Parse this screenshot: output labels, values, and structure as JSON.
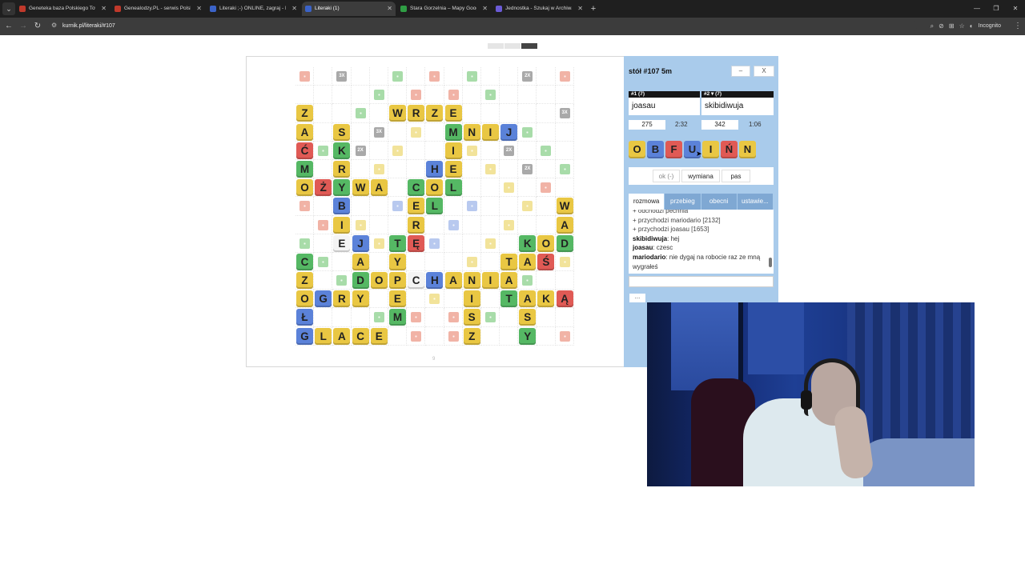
{
  "browser": {
    "tabs": [
      {
        "title": "Geneteka baza Polskiego Towa",
        "active": false,
        "icon_color": "#c0392b"
      },
      {
        "title": "Genealodzy.PL - serwis Polskiego",
        "active": false,
        "icon_color": "#c0392b"
      },
      {
        "title": "Literaki ;-) ONLINE, zagraj - Ku",
        "active": false,
        "icon_color": "#3b63c8"
      },
      {
        "title": "Literaki (1)",
        "active": true,
        "icon_color": "#3b63c8"
      },
      {
        "title": "Stara Gorzelnia – Mapy Google",
        "active": false,
        "icon_color": "#2f9e44"
      },
      {
        "title": "Jednostka - Szukaj w Archiwach",
        "active": false,
        "icon_color": "#6b5bd6"
      }
    ],
    "new_tab_label": "+",
    "url": "kurnik.pl/literaki/#107",
    "incognito_label": "Incognito"
  },
  "game": {
    "table_title": "stół #107   5m",
    "minimize_label": "–",
    "close_label": "X",
    "players": [
      {
        "header": "#1   (7)",
        "name": "joasau",
        "score": "275",
        "time": "2:32"
      },
      {
        "header": "#2 ▾ (7)",
        "name": "skibidiwuja",
        "score": "342",
        "time": "1:06"
      }
    ],
    "rack": [
      {
        "letter": "O",
        "color": "#e9c743"
      },
      {
        "letter": "B",
        "color": "#5b82d9"
      },
      {
        "letter": "F",
        "color": "#e05a55"
      },
      {
        "letter": "U",
        "color": "#5b82d9"
      },
      {
        "letter": "I",
        "color": "#e9c743"
      },
      {
        "letter": "Ń",
        "color": "#e05a55"
      },
      {
        "letter": "N",
        "color": "#e9c743"
      }
    ],
    "actions": {
      "ok": "ok (-)",
      "exchange": "wymiana",
      "pass": "pas"
    },
    "chat_tabs": [
      "rozmowa",
      "przebieg",
      "obecni",
      "ustawie..."
    ],
    "chat_lines": [
      {
        "kind": "sys",
        "text": "+ odchodzi pechnia"
      },
      {
        "kind": "sys",
        "text": "+ przychodzi mariodario [2132]"
      },
      {
        "kind": "sys",
        "text": "+ przychodzi joasau [1653]"
      },
      {
        "kind": "msg",
        "user": "skibidiwuja",
        "text": ": hej"
      },
      {
        "kind": "msg",
        "user": "joasau",
        "text": ": czesc"
      },
      {
        "kind": "msg",
        "user": "mariodario",
        "text": ": nie dygaj na robocie raz ze mną wygrałeś"
      }
    ],
    "more_label": "...",
    "board_footer": "9"
  },
  "colors": {
    "yellow": "#e9c743",
    "green": "#55b864",
    "blue": "#5b82d9",
    "red": "#e05a55",
    "white": "#f4f4f4"
  },
  "board": {
    "tiles": [
      [
        2,
        0,
        "Z",
        "y"
      ],
      [
        2,
        5,
        "W",
        "y"
      ],
      [
        2,
        6,
        "R",
        "y"
      ],
      [
        2,
        7,
        "Z",
        "y"
      ],
      [
        2,
        8,
        "E",
        "y"
      ],
      [
        3,
        0,
        "A",
        "y"
      ],
      [
        3,
        2,
        "S",
        "y"
      ],
      [
        3,
        8,
        "M",
        "g"
      ],
      [
        3,
        9,
        "N",
        "y"
      ],
      [
        3,
        10,
        "I",
        "y"
      ],
      [
        3,
        11,
        "J",
        "b"
      ],
      [
        4,
        0,
        "Ć",
        "r"
      ],
      [
        4,
        2,
        "K",
        "g"
      ],
      [
        4,
        8,
        "I",
        "y"
      ],
      [
        5,
        0,
        "M",
        "g"
      ],
      [
        5,
        2,
        "R",
        "y"
      ],
      [
        5,
        7,
        "H",
        "b"
      ],
      [
        5,
        8,
        "E",
        "y"
      ],
      [
        6,
        0,
        "O",
        "y"
      ],
      [
        6,
        1,
        "Ż",
        "r"
      ],
      [
        6,
        2,
        "Y",
        "g"
      ],
      [
        6,
        3,
        "W",
        "y"
      ],
      [
        6,
        4,
        "A",
        "y"
      ],
      [
        6,
        6,
        "C",
        "g"
      ],
      [
        6,
        7,
        "O",
        "y"
      ],
      [
        6,
        8,
        "L",
        "g"
      ],
      [
        7,
        2,
        "B",
        "b"
      ],
      [
        7,
        6,
        "E",
        "y"
      ],
      [
        7,
        7,
        "L",
        "g"
      ],
      [
        7,
        14,
        "W",
        "y"
      ],
      [
        8,
        2,
        "I",
        "y"
      ],
      [
        8,
        6,
        "R",
        "y"
      ],
      [
        8,
        14,
        "A",
        "y"
      ],
      [
        9,
        2,
        "E",
        "w"
      ],
      [
        9,
        3,
        "J",
        "b"
      ],
      [
        9,
        5,
        "T",
        "g"
      ],
      [
        9,
        6,
        "Ę",
        "r"
      ],
      [
        9,
        12,
        "K",
        "g"
      ],
      [
        9,
        13,
        "O",
        "y"
      ],
      [
        9,
        14,
        "D",
        "g"
      ],
      [
        10,
        0,
        "C",
        "g"
      ],
      [
        10,
        3,
        "A",
        "y"
      ],
      [
        10,
        5,
        "Y",
        "y"
      ],
      [
        10,
        11,
        "T",
        "y"
      ],
      [
        10,
        12,
        "A",
        "y"
      ],
      [
        10,
        13,
        "Ś",
        "r"
      ],
      [
        11,
        0,
        "Z",
        "y"
      ],
      [
        11,
        3,
        "D",
        "g"
      ],
      [
        11,
        4,
        "O",
        "y"
      ],
      [
        11,
        5,
        "P",
        "y"
      ],
      [
        11,
        6,
        "C",
        "w"
      ],
      [
        11,
        7,
        "H",
        "b"
      ],
      [
        11,
        8,
        "A",
        "y"
      ],
      [
        11,
        9,
        "N",
        "y"
      ],
      [
        11,
        10,
        "I",
        "y"
      ],
      [
        11,
        11,
        "A",
        "y"
      ],
      [
        12,
        0,
        "O",
        "y"
      ],
      [
        12,
        1,
        "G",
        "b"
      ],
      [
        12,
        2,
        "R",
        "y"
      ],
      [
        12,
        3,
        "Y",
        "y"
      ],
      [
        12,
        5,
        "E",
        "y"
      ],
      [
        12,
        9,
        "I",
        "y"
      ],
      [
        12,
        11,
        "T",
        "g"
      ],
      [
        12,
        12,
        "A",
        "y"
      ],
      [
        12,
        13,
        "K",
        "y"
      ],
      [
        12,
        14,
        "Ą",
        "r"
      ],
      [
        13,
        0,
        "Ł",
        "b"
      ],
      [
        13,
        5,
        "M",
        "g"
      ],
      [
        13,
        9,
        "S",
        "y"
      ],
      [
        13,
        12,
        "S",
        "y"
      ],
      [
        14,
        0,
        "G",
        "b"
      ],
      [
        14,
        1,
        "L",
        "y"
      ],
      [
        14,
        2,
        "A",
        "y"
      ],
      [
        14,
        3,
        "C",
        "y"
      ],
      [
        14,
        4,
        "E",
        "y"
      ],
      [
        14,
        9,
        "Z",
        "y"
      ],
      [
        14,
        12,
        "Y",
        "g"
      ]
    ],
    "premiums": [
      [
        0,
        0,
        "r",
        ""
      ],
      [
        0,
        2,
        "x",
        "3X"
      ],
      [
        0,
        5,
        "g",
        ""
      ],
      [
        0,
        7,
        "r",
        ""
      ],
      [
        0,
        9,
        "g",
        ""
      ],
      [
        0,
        12,
        "x",
        "2X"
      ],
      [
        0,
        14,
        "r",
        ""
      ],
      [
        1,
        4,
        "g",
        ""
      ],
      [
        1,
        6,
        "r",
        ""
      ],
      [
        1,
        8,
        "r",
        ""
      ],
      [
        1,
        10,
        "g",
        ""
      ],
      [
        2,
        3,
        "g",
        ""
      ],
      [
        2,
        5,
        "x",
        "2X"
      ],
      [
        2,
        14,
        "x",
        "3X"
      ],
      [
        3,
        4,
        "x",
        "3X"
      ],
      [
        3,
        6,
        "y",
        ""
      ],
      [
        3,
        12,
        "g",
        ""
      ],
      [
        4,
        1,
        "g",
        ""
      ],
      [
        4,
        3,
        "x",
        "2X"
      ],
      [
        4,
        5,
        "y",
        ""
      ],
      [
        4,
        9,
        "y",
        ""
      ],
      [
        4,
        11,
        "x",
        "2X"
      ],
      [
        4,
        13,
        "g",
        ""
      ],
      [
        5,
        4,
        "y",
        ""
      ],
      [
        5,
        10,
        "y",
        ""
      ],
      [
        5,
        12,
        "x",
        "2X"
      ],
      [
        5,
        14,
        "g",
        ""
      ],
      [
        6,
        11,
        "y",
        ""
      ],
      [
        6,
        13,
        "r",
        ""
      ],
      [
        7,
        0,
        "r",
        ""
      ],
      [
        7,
        5,
        "b",
        ""
      ],
      [
        7,
        9,
        "b",
        ""
      ],
      [
        7,
        12,
        "y",
        ""
      ],
      [
        8,
        1,
        "r",
        ""
      ],
      [
        8,
        3,
        "y",
        ""
      ],
      [
        8,
        8,
        "b",
        ""
      ],
      [
        8,
        11,
        "y",
        ""
      ],
      [
        9,
        0,
        "g",
        ""
      ],
      [
        9,
        4,
        "y",
        ""
      ],
      [
        9,
        7,
        "b",
        ""
      ],
      [
        9,
        10,
        "y",
        ""
      ],
      [
        10,
        1,
        "g",
        ""
      ],
      [
        10,
        9,
        "y",
        ""
      ],
      [
        10,
        14,
        "y",
        ""
      ],
      [
        11,
        2,
        "g",
        ""
      ],
      [
        11,
        12,
        "g",
        ""
      ],
      [
        12,
        7,
        "y",
        ""
      ],
      [
        13,
        4,
        "g",
        ""
      ],
      [
        13,
        6,
        "r",
        ""
      ],
      [
        13,
        8,
        "r",
        ""
      ],
      [
        13,
        10,
        "g",
        ""
      ],
      [
        14,
        6,
        "r",
        ""
      ],
      [
        14,
        8,
        "r",
        ""
      ],
      [
        14,
        14,
        "r",
        ""
      ]
    ],
    "premium_colors": {
      "r": "#f1b3a6",
      "g": "#a8dca9",
      "y": "#f2e39a",
      "b": "#b8c9ef",
      "x": "#a9a9a9"
    }
  }
}
